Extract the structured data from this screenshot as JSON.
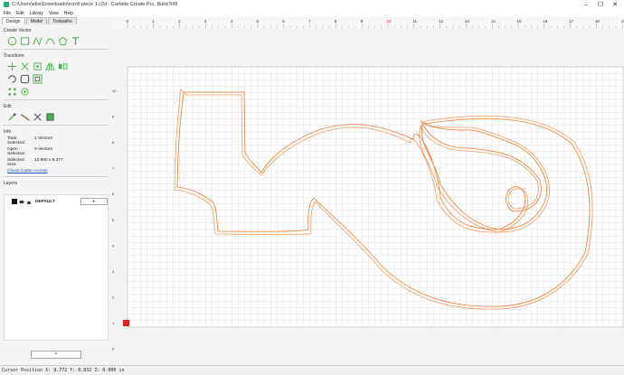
{
  "window": {
    "title": "C:\\Users\\ellis\\Downloads\\scroll piece 1.c2d - Carbide Create Pro, Build 549",
    "min": "–",
    "max": "☐",
    "close": "✕"
  },
  "menu": [
    "File",
    "Edit",
    "Library",
    "View",
    "Help"
  ],
  "tabs": [
    "Design",
    "Model",
    "Toolpaths"
  ],
  "sections": {
    "create_vector": "Create Vector",
    "transform": "Transform",
    "edit": "Edit",
    "info": "Info",
    "layers": "Layers"
  },
  "info": {
    "total_label": "Total Selected:",
    "total_value": "1 Vectors",
    "open_label": "Open Selected:",
    "open_value": "0 Vectors",
    "size_label": "Selected Size:",
    "size_value": "13.960 x 8.377",
    "check_link": "Check Cutter Access"
  },
  "layers": {
    "name": "DEFAULT",
    "add_label": "+"
  },
  "ruler": {
    "x_labels": [
      "0",
      "1",
      "2",
      "3",
      "4",
      "5",
      "6",
      "7",
      "8",
      "9",
      "10",
      "11",
      "12",
      "13",
      "14",
      "15",
      "16",
      "17",
      "18",
      "19"
    ],
    "y_labels": [
      "10",
      "9",
      "8",
      "7",
      "6",
      "5",
      "4",
      "3",
      "2",
      "1",
      "0"
    ]
  },
  "status": {
    "cursor": "Cursor Position X: 9.772 Y: 8.832 Z: 0.000 in"
  },
  "colors": {
    "accent": "#4caf50",
    "shape": "#f07a2e",
    "grid": "#dcdcdc",
    "origin": "#e02020"
  }
}
